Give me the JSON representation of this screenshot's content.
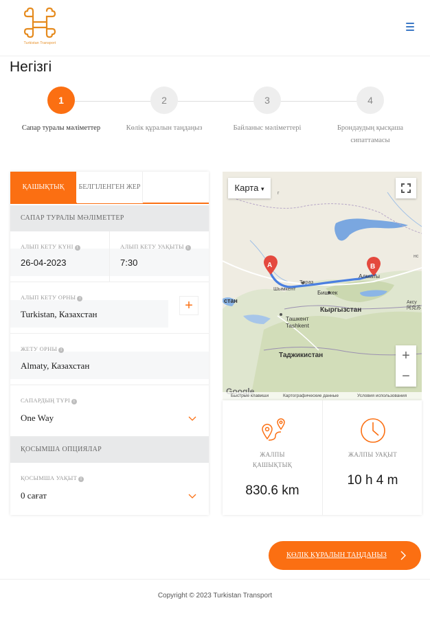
{
  "header": {
    "logo_text": "Turkistan Transport",
    "menu_icon": "hamburger-icon",
    "accent_color": "#fb6f12",
    "logo_color": "#e58a1d",
    "menu_color": "#3b78c5"
  },
  "page_title": "Негізгі",
  "stepper": {
    "steps": [
      {
        "number": "1",
        "label": "Сапар туралы мәліметтер",
        "active": true
      },
      {
        "number": "2",
        "label": "Көлік құралын таңдаңыз",
        "active": false
      },
      {
        "number": "3",
        "label": "Байланыс мәліметтері",
        "active": false
      },
      {
        "number": "4",
        "label": "Брондаудың қысқаша сипаттамасы",
        "active": false
      }
    ]
  },
  "tabs": {
    "distance": "Қашықтық",
    "fixed_place": "Белгіленген жер"
  },
  "trip_details": {
    "section_title": "Сапар туралы мәліметтер",
    "departure_date_label": "Алып кету күні",
    "departure_date_value": "26-04-2023",
    "departure_time_label": "Алып кету уақыты",
    "departure_time_value": "7:30",
    "pickup_place_label": "Алып кету орны",
    "pickup_place_value": "Turkistan, Казахстан",
    "add_stop_symbol": "+",
    "destination_label": "Жету орны",
    "destination_value": "Almaty, Казахстан",
    "trip_type_label": "Сапардың түрі",
    "trip_type_value": "One Way"
  },
  "extra_options": {
    "section_title": "Қосымша опциялар",
    "extra_time_label": "Қосымша уақыт",
    "extra_time_value": "0 сағат"
  },
  "map": {
    "type_button": "Карта",
    "marker_a": "A",
    "marker_b": "B",
    "labels": {
      "kyrgyzstan": "Кыргызстан",
      "tajikistan": "Таджикистан",
      "tashkent_ru": "Ташкент",
      "tashkent_en": "Tashkent",
      "almaty": "Алматы",
      "bishkek": "Бишкек",
      "shymkent": "Шымкент",
      "taraz": "Тараз",
      "kazakhstan_edge": "стан",
      "aksu": "Аксу",
      "aksu_sub": "阿克苏",
      "g": "г",
      "nc": "нс"
    },
    "zoom_in": "+",
    "zoom_out": "−",
    "google": "Google",
    "footer_shortcuts": "Быстрые клавиши",
    "footer_data": "Картографические данные",
    "footer_terms": "Условия использования"
  },
  "stats": {
    "distance_label": "Жалпы қашықтық",
    "distance_value": "830.6 km",
    "distance_icon": "route-pin-icon",
    "time_label": "Жалпы уақыт",
    "time_value": "10 h 4 m",
    "time_icon": "clock-icon"
  },
  "cta": {
    "label": "Көлік құралын таңдаңыз"
  },
  "footer": {
    "copyright": "Copyright © 2023 Turkistan Transport"
  }
}
